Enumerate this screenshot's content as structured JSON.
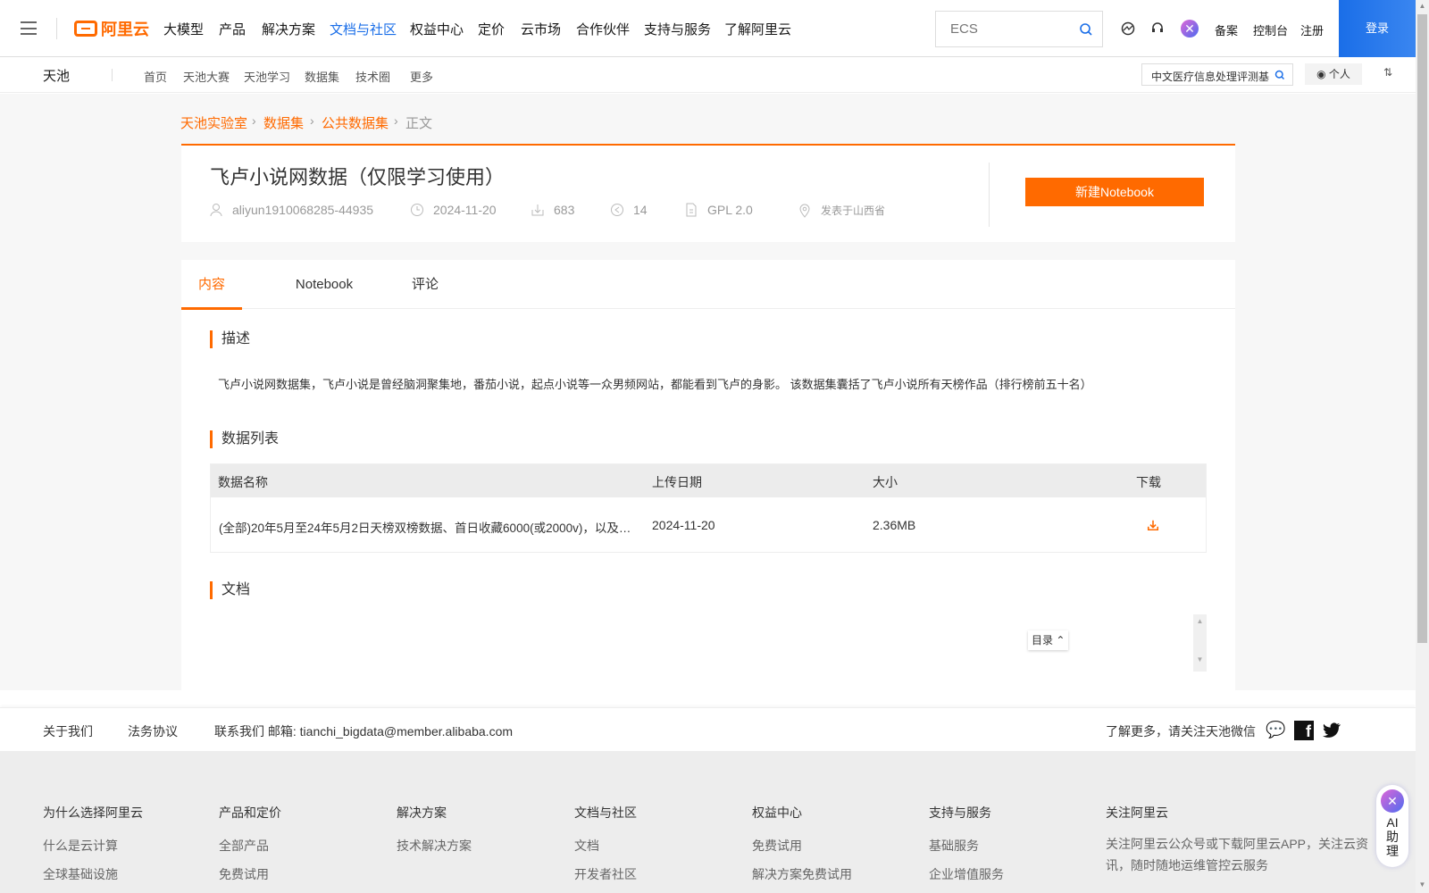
{
  "topnav": {
    "logo": "阿里云",
    "items": [
      "大模型",
      "产品",
      "解决方案",
      "文档与社区",
      "权益中心",
      "定价",
      "云市场",
      "合作伙伴",
      "支持与服务",
      "了解阿里云"
    ],
    "active_index": 3,
    "search_placeholder": "ECS",
    "links": [
      "备案",
      "控制台",
      "注册"
    ],
    "login": "登录"
  },
  "subnav": {
    "brand": "天池",
    "items": [
      "首页",
      "天池大赛",
      "天池学习",
      "数据集",
      "技术圈",
      "更多"
    ],
    "search_value": "中文医疗信息处理评测基",
    "personal": "个人"
  },
  "breadcrumb": [
    "天池实验室",
    "数据集",
    "公共数据集",
    "正文"
  ],
  "dataset": {
    "title": "飞卢小说网数据（仅限学习使用）",
    "author": "aliyun1910068285-44935",
    "date": "2024-11-20",
    "downloads": "683",
    "shares": "14",
    "license": "GPL 2.0",
    "location": "发表于山西省",
    "new_notebook": "新建Notebook"
  },
  "tabs": [
    "内容",
    "Notebook",
    "评论"
  ],
  "content": {
    "desc_title": "描述",
    "desc": "飞卢小说网数据集，飞卢小说是曾经脑洞聚集地，番茄小说，起点小说等一众男频网站，都能看到飞卢的身影。 该数据集囊括了飞卢小说所有天榜作品（排行榜前五十名）",
    "list_title": "数据列表",
    "columns": [
      "数据名称",
      "上传日期",
      "大小",
      "下载"
    ],
    "rows": [
      {
        "name": "(全部)20年5月至24年5月2日天榜双榜数据、首日收藏6000(或2000v)，以及…",
        "date": "2024-11-20",
        "size": "2.36MB"
      }
    ],
    "doc_title": "文档",
    "toc": "目录"
  },
  "footer": {
    "links": [
      "关于我们",
      "法务协议",
      "联系我们 邮箱: tianchi_bigdata@member.alibaba.com"
    ],
    "follow": "了解更多，请关注天池微信",
    "columns": [
      {
        "title": "为什么选择阿里云",
        "items": [
          "什么是云计算",
          "全球基础设施"
        ]
      },
      {
        "title": "产品和定价",
        "items": [
          "全部产品",
          "免费试用"
        ]
      },
      {
        "title": "解决方案",
        "items": [
          "技术解决方案"
        ]
      },
      {
        "title": "文档与社区",
        "items": [
          "文档",
          "开发者社区"
        ]
      },
      {
        "title": "权益中心",
        "items": [
          "免费试用",
          "解决方案免费试用"
        ]
      },
      {
        "title": "支持与服务",
        "items": [
          "基础服务",
          "企业增值服务"
        ]
      },
      {
        "title": "关注阿里云",
        "items": [
          "关注阿里云公众号或下载阿里云APP，关注云资讯，随时随地运维管控云服务"
        ]
      }
    ]
  },
  "ai": {
    "label": "AI助理"
  },
  "colors": {
    "accent": "#ff6a00",
    "blue": "#1a6ee8"
  }
}
